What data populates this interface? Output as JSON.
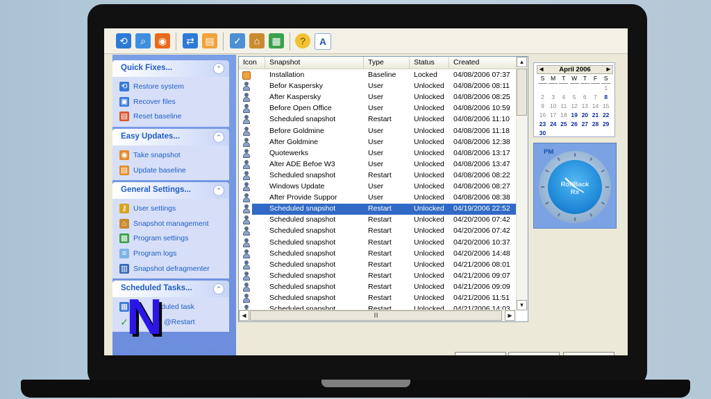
{
  "sidebar": {
    "groups": [
      {
        "title": "Quick Fixes...",
        "items": [
          {
            "label": "Restore system",
            "icon": "restore-icon"
          },
          {
            "label": "Recover files",
            "icon": "recover-files-icon"
          },
          {
            "label": "Reset baseline",
            "icon": "reset-baseline-icon"
          }
        ]
      },
      {
        "title": "Easy Updates...",
        "items": [
          {
            "label": "Take snapshot",
            "icon": "take-snapshot-icon"
          },
          {
            "label": "Update baseline",
            "icon": "update-baseline-icon"
          }
        ]
      },
      {
        "title": "General Settings...",
        "items": [
          {
            "label": "User settings",
            "icon": "keys-icon"
          },
          {
            "label": "Snapshot management",
            "icon": "house-icon"
          },
          {
            "label": "Program settings",
            "icon": "program-settings-icon"
          },
          {
            "label": "Program logs",
            "icon": "logs-icon"
          },
          {
            "label": "Snapshot defragmenter",
            "icon": "defrag-icon"
          }
        ]
      },
      {
        "title": "Scheduled Tasks...",
        "items": [
          {
            "label": "duled task",
            "icon": "calendar-task-icon"
          },
          {
            "label": "@Restart",
            "icon": "checkmark-icon"
          }
        ]
      }
    ]
  },
  "list": {
    "columns": [
      "Icon",
      "Snapshot",
      "Type",
      "Status",
      "Created"
    ],
    "rows": [
      {
        "snapshot": "Installation",
        "type": "Baseline",
        "status": "Locked",
        "created": "04/08/2006 07:37",
        "icon": "baseline-icon"
      },
      {
        "snapshot": "Befor Kaspersky",
        "type": "User",
        "status": "Unlocked",
        "created": "04/08/2006 08:11",
        "icon": "user-icon"
      },
      {
        "snapshot": "After Kaspersky",
        "type": "User",
        "status": "Unlocked",
        "created": "04/08/2006 08:25",
        "icon": "user-icon"
      },
      {
        "snapshot": "Before Open Office",
        "type": "User",
        "status": "Unlocked",
        "created": "04/08/2006 10:59",
        "icon": "user-icon"
      },
      {
        "snapshot": "Scheduled snapshot",
        "type": "Restart",
        "status": "Unlocked",
        "created": "04/08/2006 11:10",
        "icon": "user-icon"
      },
      {
        "snapshot": "Before Goldmine",
        "type": "User",
        "status": "Unlocked",
        "created": "04/08/2006 11:18",
        "icon": "user-icon"
      },
      {
        "snapshot": "After Goldmine",
        "type": "User",
        "status": "Unlocked",
        "created": "04/08/2006 12:38",
        "icon": "user-icon"
      },
      {
        "snapshot": "Quotewerks",
        "type": "User",
        "status": "Unlocked",
        "created": "04/08/2006 13:17",
        "icon": "user-icon"
      },
      {
        "snapshot": "Alter ADE Befoe W3",
        "type": "User",
        "status": "Unlocked",
        "created": "04/08/2006 13:47",
        "icon": "user-icon"
      },
      {
        "snapshot": "Scheduled snapshot",
        "type": "Restart",
        "status": "Unlocked",
        "created": "04/08/2006 08:22",
        "icon": "user-icon"
      },
      {
        "snapshot": "Windows Update",
        "type": "User",
        "status": "Unlocked",
        "created": "04/08/2006 08:27",
        "icon": "user-icon"
      },
      {
        "snapshot": "After Provide Suppor",
        "type": "User",
        "status": "Unlocked",
        "created": "04/08/2006 08:38",
        "icon": "user-icon"
      },
      {
        "snapshot": "Scheduled snapshot",
        "type": "Restart",
        "status": "Unlocked",
        "created": "04/19/2006 22:52",
        "icon": "user-icon",
        "selected": true
      },
      {
        "snapshot": "Scheduled snapshot",
        "type": "Restart",
        "status": "Unlocked",
        "created": "04/20/2006 07:42",
        "icon": "user-icon"
      },
      {
        "snapshot": "Scheduled snapshot",
        "type": "Restart",
        "status": "Unlocked",
        "created": "04/20/2006 07:42",
        "icon": "user-icon"
      },
      {
        "snapshot": "Scheduled snapshot",
        "type": "Restart",
        "status": "Unlocked",
        "created": "04/20/2006 10:37",
        "icon": "user-icon"
      },
      {
        "snapshot": "Scheduled snapshot",
        "type": "Restart",
        "status": "Unlocked",
        "created": "04/20/2006 14:48",
        "icon": "user-icon"
      },
      {
        "snapshot": "Scheduled snapshot",
        "type": "Restart",
        "status": "Unlocked",
        "created": "04/21/2006 08:01",
        "icon": "user-icon"
      },
      {
        "snapshot": "Scheduled snapshot",
        "type": "Restart",
        "status": "Unlocked",
        "created": "04/21/2006 09:07",
        "icon": "user-icon"
      },
      {
        "snapshot": "Scheduled snapshot",
        "type": "Restart",
        "status": "Unlocked",
        "created": "04/21/2006 09:09",
        "icon": "user-icon"
      },
      {
        "snapshot": "Scheduled snapshot",
        "type": "Restart",
        "status": "Unlocked",
        "created": "04/21/2006 11:51",
        "icon": "user-icon"
      },
      {
        "snapshot": "Scheduled snapshot",
        "type": "Restart",
        "status": "Unlocked",
        "created": "04/21/2006 14:03",
        "icon": "user-icon"
      }
    ],
    "hscroll_grip": "|||"
  },
  "calendar": {
    "month_label": "April 2006",
    "prev": "◀",
    "next": "▶",
    "weekdays": [
      "S",
      "M",
      "T",
      "W",
      "T",
      "F",
      "S"
    ],
    "weeks": [
      [
        "",
        "",
        "",
        "",
        "",
        "",
        "1"
      ],
      [
        "2",
        "3",
        "4",
        "5",
        "6",
        "7",
        "8"
      ],
      [
        "9",
        "10",
        "11",
        "12",
        "13",
        "14",
        "15"
      ],
      [
        "16",
        "17",
        "18",
        "19",
        "20",
        "21",
        "22"
      ],
      [
        "23",
        "24",
        "25",
        "26",
        "27",
        "28",
        "29"
      ],
      [
        "30",
        "",
        "",
        "",
        "",
        "",
        ""
      ]
    ],
    "snapshot_days": [
      "8",
      "19",
      "20",
      "21",
      "22",
      "23",
      "24",
      "25",
      "26",
      "27",
      "28",
      "29",
      "30"
    ],
    "colors": {
      "past": "#888888",
      "snapshot": "#0a2a9c",
      "normal": "#000000"
    }
  },
  "clock": {
    "period": "PM",
    "brand_line1": "RollBack",
    "brand_line2": "Rx"
  },
  "toolbar": {
    "icons": [
      "restore-icon",
      "search-icon",
      "snapshot-icon",
      "copy-icon",
      "export-icon",
      "schedule-icon",
      "home-icon",
      "settings-icon",
      "help-icon",
      "font-icon"
    ]
  },
  "overlay": {
    "logo": "N"
  }
}
